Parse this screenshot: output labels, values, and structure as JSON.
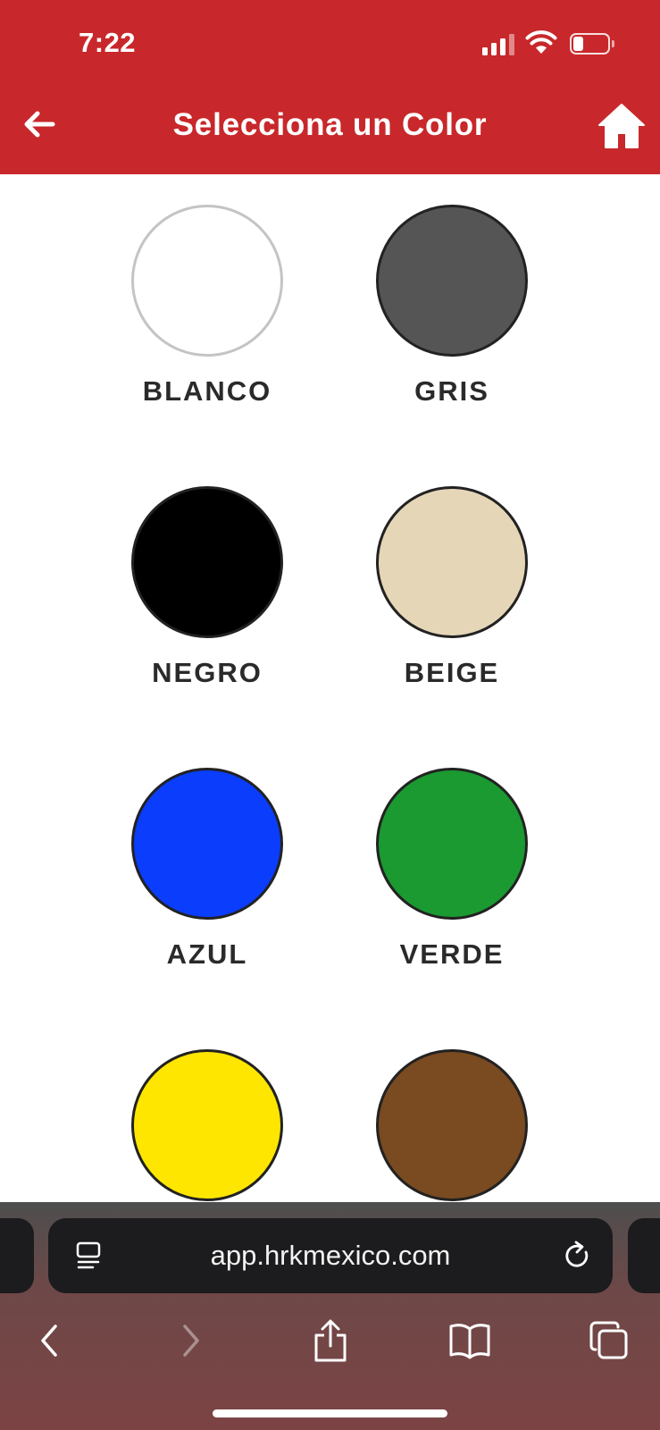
{
  "status_bar": {
    "time": "7:22",
    "battery_level": 0.3
  },
  "header": {
    "title": "Selecciona un Color"
  },
  "colors": [
    {
      "label": "BLANCO",
      "hex": "#ffffff"
    },
    {
      "label": "GRIS",
      "hex": "#555555"
    },
    {
      "label": "NEGRO",
      "hex": "#000000"
    },
    {
      "label": "BEIGE",
      "hex": "#e6d6b8"
    },
    {
      "label": "AZUL",
      "hex": "#0a3dfc"
    },
    {
      "label": "VERDE",
      "hex": "#1a9a30"
    },
    {
      "label": "",
      "hex": "#ffe600"
    },
    {
      "label": "",
      "hex": "#7a4a20"
    }
  ],
  "browser": {
    "url": "app.hrkmexico.com"
  },
  "theme": {
    "header_bg": "#c8282b",
    "label_color": "#2a2a2a"
  }
}
